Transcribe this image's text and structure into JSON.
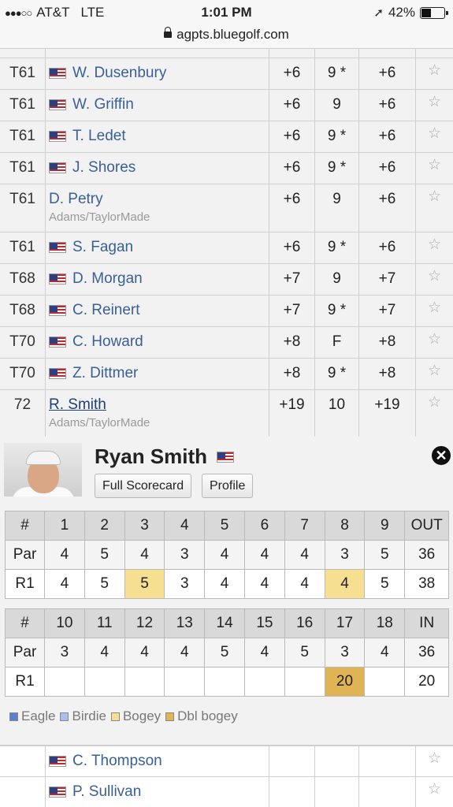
{
  "status": {
    "carrier": "AT&T",
    "network": "LTE",
    "time": "1:01 PM",
    "battery": "42%",
    "battery_level": 0.42
  },
  "url": "agpts.bluegolf.com",
  "rows": [
    {
      "pos": "T61",
      "name": "W. Dusenbury",
      "flag": true,
      "sponsor": "",
      "total": "+6",
      "thru": "9 *",
      "today": "+6"
    },
    {
      "pos": "T61",
      "name": "W. Griffin",
      "flag": true,
      "sponsor": "",
      "total": "+6",
      "thru": "9",
      "today": "+6"
    },
    {
      "pos": "T61",
      "name": "T. Ledet",
      "flag": true,
      "sponsor": "",
      "total": "+6",
      "thru": "9 *",
      "today": "+6"
    },
    {
      "pos": "T61",
      "name": "J. Shores",
      "flag": true,
      "sponsor": "",
      "total": "+6",
      "thru": "9 *",
      "today": "+6"
    },
    {
      "pos": "T61",
      "name": "D. Petry",
      "flag": false,
      "sponsor": "Adams/TaylorMade",
      "total": "+6",
      "thru": "9",
      "today": "+6"
    },
    {
      "pos": "T61",
      "name": "S. Fagan",
      "flag": true,
      "sponsor": "",
      "total": "+6",
      "thru": "9 *",
      "today": "+6"
    },
    {
      "pos": "T68",
      "name": "D. Morgan",
      "flag": true,
      "sponsor": "",
      "total": "+7",
      "thru": "9",
      "today": "+7"
    },
    {
      "pos": "T68",
      "name": "C. Reinert",
      "flag": true,
      "sponsor": "",
      "total": "+7",
      "thru": "9 *",
      "today": "+7"
    },
    {
      "pos": "T70",
      "name": "C. Howard",
      "flag": true,
      "sponsor": "",
      "total": "+8",
      "thru": "F",
      "today": "+8"
    },
    {
      "pos": "T70",
      "name": "Z. Dittmer",
      "flag": true,
      "sponsor": "",
      "total": "+8",
      "thru": "9 *",
      "today": "+8"
    },
    {
      "pos": "72",
      "name": "R. Smith",
      "flag": false,
      "sponsor": "Adams/TaylorMade",
      "total": "+19",
      "thru": "10",
      "today": "+19",
      "link": true
    }
  ],
  "player": {
    "name": "Ryan Smith",
    "full_scorecard_label": "Full Scorecard",
    "profile_label": "Profile"
  },
  "front": {
    "header": [
      "#",
      "1",
      "2",
      "3",
      "4",
      "5",
      "6",
      "7",
      "8",
      "9",
      "OUT"
    ],
    "par": [
      "Par",
      "4",
      "5",
      "4",
      "3",
      "4",
      "4",
      "4",
      "3",
      "5",
      "36"
    ],
    "r1": [
      "R1",
      "4",
      "5",
      "5",
      "3",
      "4",
      "4",
      "4",
      "4",
      "5",
      "38"
    ],
    "r1_marks": [
      "",
      "",
      "",
      "bogey",
      "",
      "",
      "",
      "",
      "bogey",
      "",
      ""
    ]
  },
  "back": {
    "header": [
      "#",
      "10",
      "11",
      "12",
      "13",
      "14",
      "15",
      "16",
      "17",
      "18",
      "IN"
    ],
    "par": [
      "Par",
      "3",
      "4",
      "4",
      "4",
      "5",
      "4",
      "5",
      "3",
      "4",
      "36"
    ],
    "r1": [
      "R1",
      "",
      "",
      "",
      "",
      "",
      "",
      "",
      "20",
      "",
      "20"
    ],
    "r1_marks": [
      "",
      "",
      "",
      "",
      "",
      "",
      "",
      "",
      "dbl",
      "",
      ""
    ]
  },
  "legend": [
    {
      "label": "Eagle",
      "color": "#5b7fd1"
    },
    {
      "label": "Birdie",
      "color": "#a9c0ea"
    },
    {
      "label": "Bogey",
      "color": "#f6df90"
    },
    {
      "label": "Dbl bogey",
      "color": "#e0b354"
    }
  ],
  "bottom_rows": [
    {
      "name": "C. Thompson",
      "flag": true
    },
    {
      "name": "P. Sullivan",
      "flag": true
    }
  ],
  "icons": {
    "star": "☆",
    "close": "✕",
    "location": "➚"
  }
}
